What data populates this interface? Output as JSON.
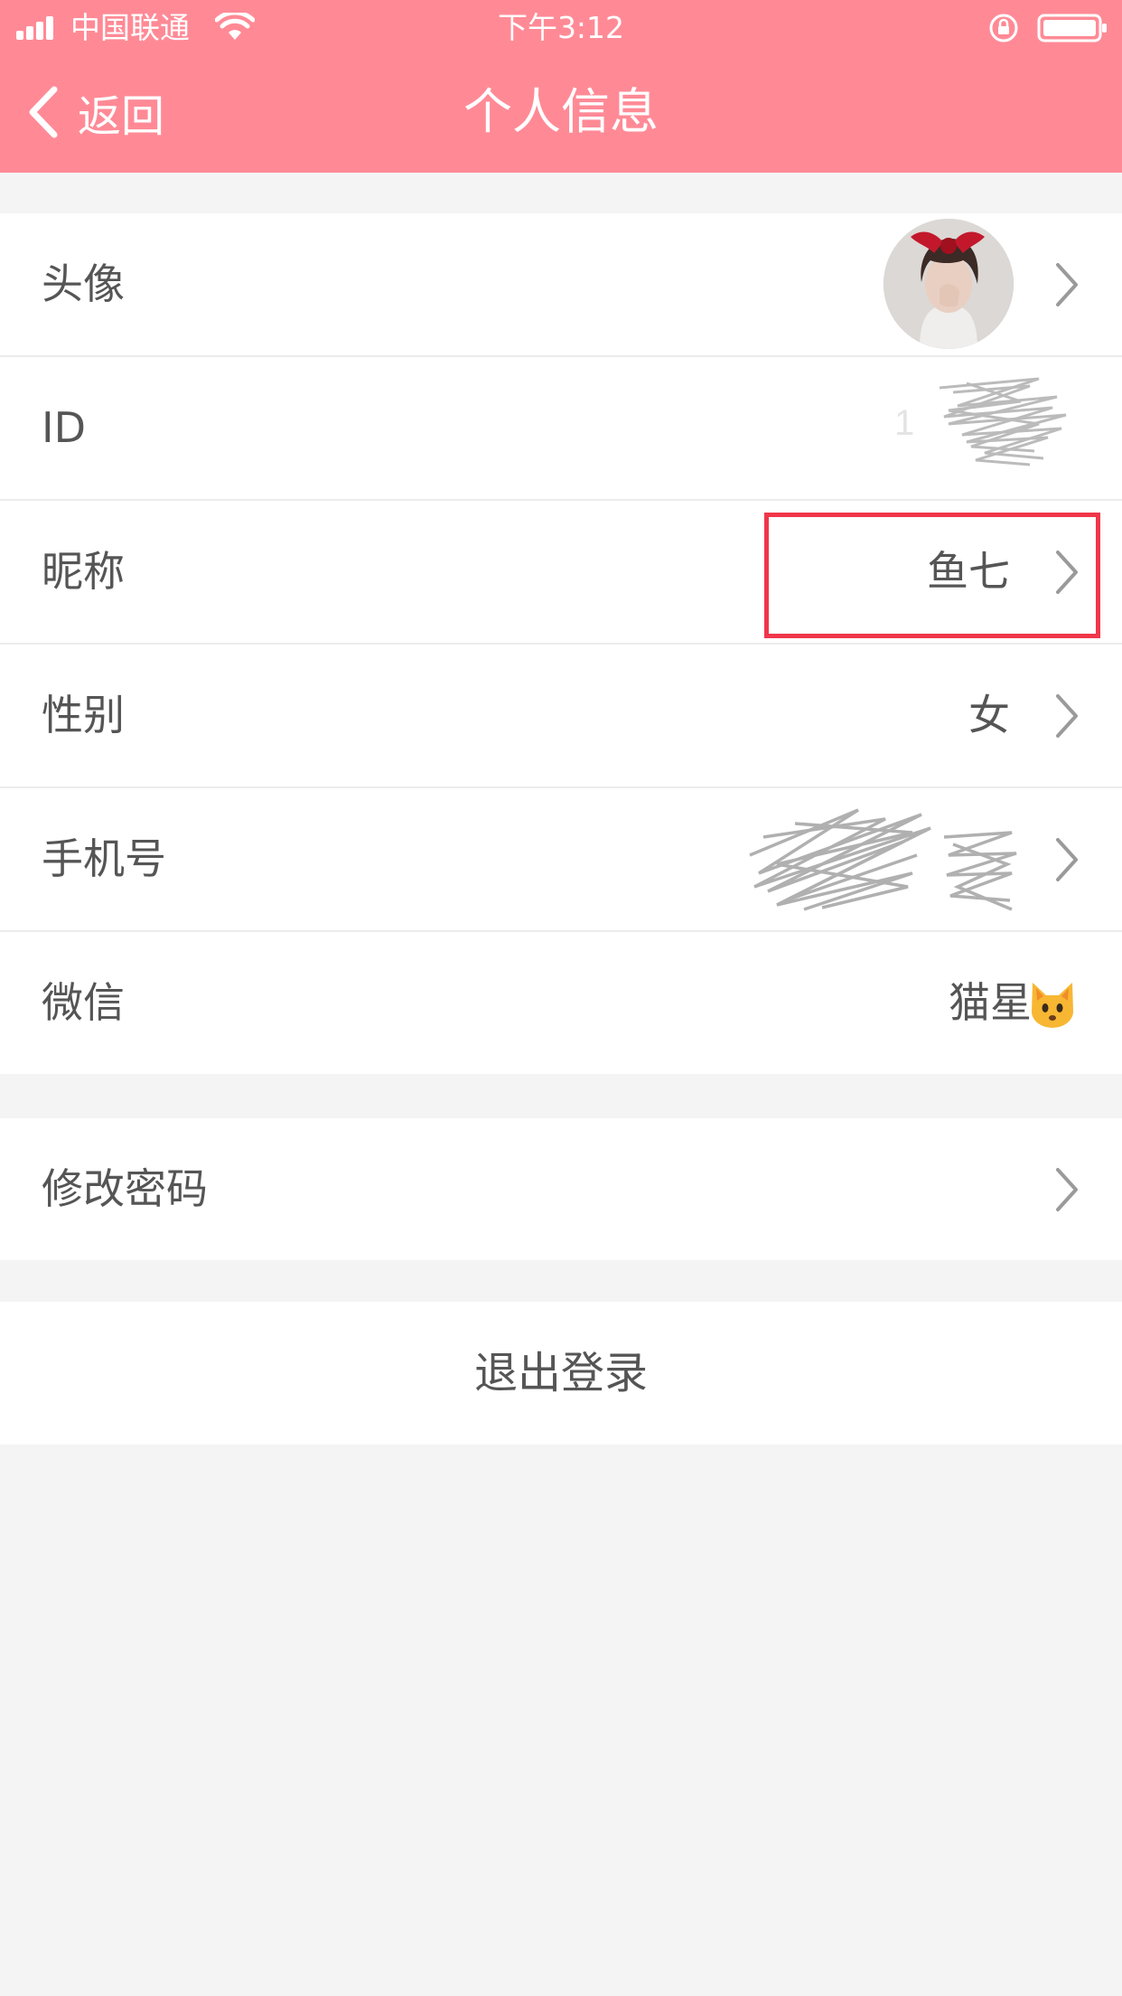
{
  "status_bar": {
    "carrier": "中国联通",
    "time": "下午3:12"
  },
  "nav": {
    "back_label": "返回",
    "title": "个人信息"
  },
  "rows": [
    {
      "label": "头像",
      "value": "",
      "has_chevron": true
    },
    {
      "label": "ID",
      "value": "",
      "has_chevron": false
    },
    {
      "label": "昵称",
      "value": "鱼七",
      "has_chevron": true
    },
    {
      "label": "性别",
      "value": "女",
      "has_chevron": true
    },
    {
      "label": "手机号",
      "value": "",
      "has_chevron": true
    },
    {
      "label": "微信",
      "value": "猫星",
      "has_chevron": false
    }
  ],
  "change_password": {
    "label": "修改密码"
  },
  "logout": {
    "label": "退出登录"
  },
  "colors": {
    "header": "#ff8a96",
    "highlight": "#f0364a",
    "background": "#f4f4f4"
  }
}
